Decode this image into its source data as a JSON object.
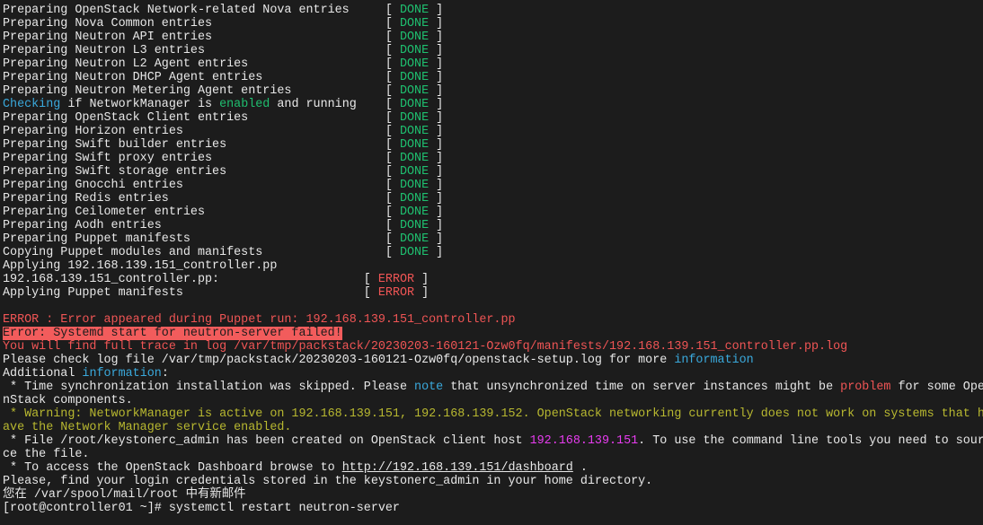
{
  "terminal": {
    "status_rows": [
      {
        "text": "Preparing OpenStack Network-related Nova entries",
        "status": "DONE"
      },
      {
        "text": "Preparing Nova Common entries",
        "status": "DONE"
      },
      {
        "text": "Preparing Neutron API entries",
        "status": "DONE"
      },
      {
        "text": "Preparing Neutron L3 entries",
        "status": "DONE"
      },
      {
        "text": "Preparing Neutron L2 Agent entries",
        "status": "DONE"
      },
      {
        "text": "Preparing Neutron DHCP Agent entries",
        "status": "DONE"
      },
      {
        "text": "Preparing Neutron Metering Agent entries",
        "status": "DONE"
      },
      {
        "segments": [
          {
            "t": "Checking",
            "c": "c"
          },
          {
            "t": " if NetworkManager is ",
            "c": "w"
          },
          {
            "t": "enabled",
            "c": "g"
          },
          {
            "t": " and running",
            "c": "w"
          }
        ],
        "status": "DONE"
      },
      {
        "text": "Preparing OpenStack Client entries",
        "status": "DONE"
      },
      {
        "text": "Preparing Horizon entries",
        "status": "DONE"
      },
      {
        "text": "Preparing Swift builder entries",
        "status": "DONE"
      },
      {
        "text": "Preparing Swift proxy entries",
        "status": "DONE"
      },
      {
        "text": "Preparing Swift storage entries",
        "status": "DONE"
      },
      {
        "text": "Preparing Gnocchi entries",
        "status": "DONE"
      },
      {
        "text": "Preparing Redis entries",
        "status": "DONE"
      },
      {
        "text": "Preparing Ceilometer entries",
        "status": "DONE"
      },
      {
        "text": "Preparing Aodh entries",
        "status": "DONE"
      },
      {
        "text": "Preparing Puppet manifests",
        "status": "DONE"
      },
      {
        "text": "Copying Puppet modules and manifests",
        "status": "DONE"
      },
      {
        "text": "Applying 192.168.139.151_controller.pp"
      },
      {
        "text": "192.168.139.151_controller.pp:",
        "status": "ERROR"
      },
      {
        "text": "Applying Puppet manifests",
        "status": "ERROR"
      }
    ],
    "rows": [
      [],
      [
        {
          "t": "ERROR : Error appeared during Puppet run: 192.168.139.151_controller.pp",
          "c": "r"
        }
      ],
      [
        {
          "t": "Error: Systemd start for neutron-server failed!",
          "c": "rbg"
        }
      ],
      [
        {
          "t": "You will find full trace in log /var/tmp/packstack/20230203-160121-Ozw0fq/manifests/192.168.139.151_controller.pp.log",
          "c": "r"
        }
      ],
      [
        {
          "t": "Please check log file /var/tmp/packstack/20230203-160121-Ozw0fq/openstack-setup.log for more ",
          "c": "w"
        },
        {
          "t": "information",
          "c": "c"
        }
      ],
      [
        {
          "t": "Additional ",
          "c": "w"
        },
        {
          "t": "information",
          "c": "c"
        },
        {
          "t": ":",
          "c": "w"
        }
      ],
      [
        {
          "t": " * Time synchronization installation was skipped. Please ",
          "c": "w"
        },
        {
          "t": "note",
          "c": "c"
        },
        {
          "t": " that unsynchronized time on server instances might be ",
          "c": "w"
        },
        {
          "t": "problem",
          "c": "r"
        },
        {
          "t": " for some Ope",
          "c": "w"
        }
      ],
      [
        {
          "t": "nStack components.",
          "c": "w"
        }
      ],
      [
        {
          "t": " * Warning: NetworkManager is active on 192.168.139.151, 192.168.139.152. OpenStack networking currently does not work on systems that h",
          "c": "y"
        }
      ],
      [
        {
          "t": "ave the Network Manager service enabled.",
          "c": "y"
        }
      ],
      [
        {
          "t": " * File /root/keystonerc_admin has been created on OpenStack client host ",
          "c": "w"
        },
        {
          "t": "192.168.139.151",
          "c": "m"
        },
        {
          "t": ". To use the command line tools you need to sour",
          "c": "w"
        }
      ],
      [
        {
          "t": "ce the file.",
          "c": "w"
        }
      ],
      [
        {
          "t": " * To access the OpenStack Dashboard browse to ",
          "c": "w"
        },
        {
          "t": "http://192.168.139.151/dashboard",
          "c": "u",
          "link": true
        },
        {
          "t": " .",
          "c": "w"
        }
      ],
      [
        {
          "t": "Please, find your login credentials stored in the keystonerc_admin in your home directory.",
          "c": "w"
        }
      ],
      [
        {
          "t": "您在 /var/spool/mail/root 中有新邮件",
          "c": "w"
        }
      ],
      [
        {
          "t": "[root@controller01 ~]# systemctl restart neutron-server",
          "c": "w",
          "prompt": true
        }
      ]
    ]
  },
  "colors": {
    "background": "#1c1c1c",
    "done": "#1fbf6f",
    "error": "#f05555",
    "cyan": "#3aa9dc",
    "warning": "#b8b830",
    "magenta": "#e83cf0"
  }
}
